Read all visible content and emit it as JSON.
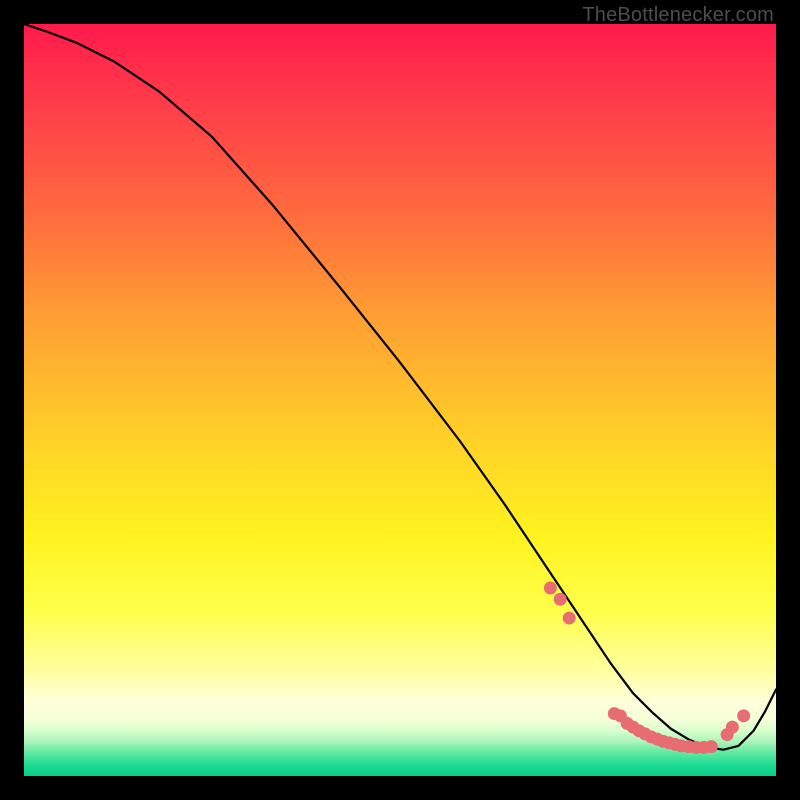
{
  "watermark": "TheBottlenecker.com",
  "chart_data": {
    "type": "line",
    "title": "",
    "xlabel": "",
    "ylabel": "",
    "xlim": [
      0,
      100
    ],
    "ylim": [
      0,
      100
    ],
    "note": "No axis labels or tick labels are rendered; values are fractions of the plot area (0–100).",
    "series": [
      {
        "name": "curve",
        "x": [
          0,
          3,
          7,
          12,
          18,
          25,
          33,
          42,
          50,
          58,
          64,
          70,
          72,
          75,
          78,
          81,
          83.5,
          86,
          88.5,
          91,
          93,
          95,
          97,
          98.5,
          100
        ],
        "y": [
          100,
          99,
          97.5,
          95,
          91,
          85,
          76,
          65,
          55,
          44.5,
          36,
          27,
          24,
          19.5,
          15,
          11,
          8.5,
          6.3,
          4.8,
          3.8,
          3.5,
          4.0,
          6.0,
          8.5,
          11.5
        ]
      }
    ],
    "markers": {
      "name": "highlight-dots",
      "color": "#e86d72",
      "points": [
        {
          "x": 70.0,
          "y": 25.0
        },
        {
          "x": 71.3,
          "y": 23.5
        },
        {
          "x": 72.5,
          "y": 21.0
        },
        {
          "x": 78.5,
          "y": 8.3
        },
        {
          "x": 79.3,
          "y": 8.0
        },
        {
          "x": 80.2,
          "y": 7.0
        },
        {
          "x": 81.0,
          "y": 6.5
        },
        {
          "x": 81.8,
          "y": 6.0
        },
        {
          "x": 82.6,
          "y": 5.6
        },
        {
          "x": 83.4,
          "y": 5.2
        },
        {
          "x": 84.2,
          "y": 4.9
        },
        {
          "x": 85.0,
          "y": 4.6
        },
        {
          "x": 85.8,
          "y": 4.4
        },
        {
          "x": 86.6,
          "y": 4.2
        },
        {
          "x": 87.4,
          "y": 4.0
        },
        {
          "x": 88.4,
          "y": 3.9
        },
        {
          "x": 89.4,
          "y": 3.8
        },
        {
          "x": 90.4,
          "y": 3.8
        },
        {
          "x": 91.4,
          "y": 3.9
        },
        {
          "x": 93.5,
          "y": 5.5
        },
        {
          "x": 94.2,
          "y": 6.5
        },
        {
          "x": 95.7,
          "y": 8.0
        }
      ]
    }
  }
}
